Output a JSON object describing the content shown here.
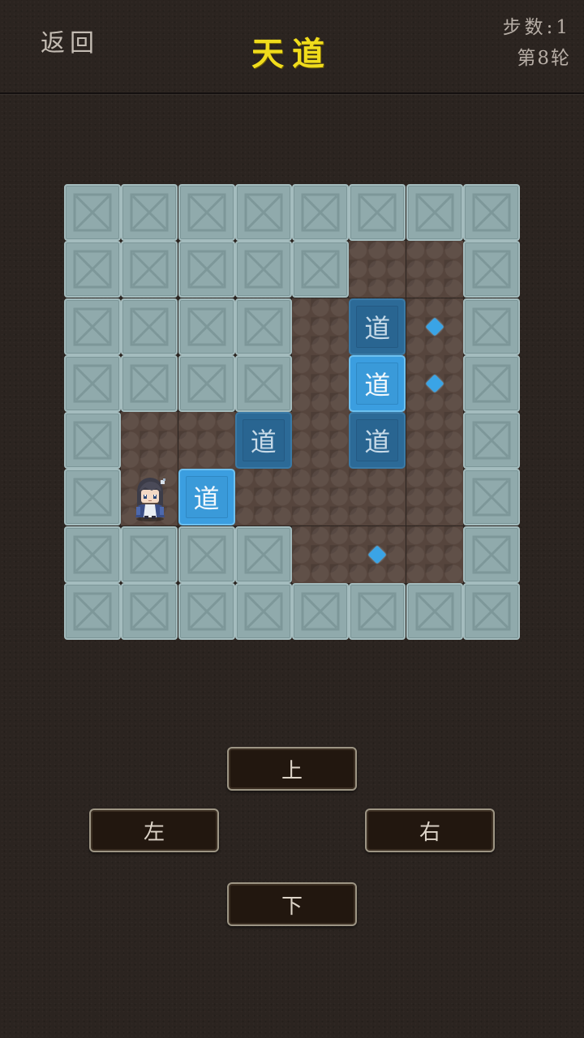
{
  "header": {
    "back_label": "返回",
    "title": "天道",
    "steps": "步数:1",
    "round": "第8轮"
  },
  "box_glyph": "道",
  "controls": {
    "up": "上",
    "left": "左",
    "right": "右",
    "down": "下"
  },
  "colors": {
    "title": "#f0dc1c",
    "wall": "#90aaac",
    "floor": "#56453d",
    "box": "#2c6a97",
    "box_on_goal": "#3b9ee0",
    "goal": "#3aa4e6"
  },
  "board": {
    "columns": 8,
    "rows": 8,
    "legend": {
      "#": "wall",
      ".": "floor"
    },
    "grid": [
      "########",
      "#####..#",
      "####...#",
      "####...#",
      "#......#",
      "#......#",
      "####...#",
      "########"
    ],
    "boxes": [
      {
        "row": 2,
        "col": 5,
        "on_goal": false
      },
      {
        "row": 3,
        "col": 5,
        "on_goal": true
      },
      {
        "row": 4,
        "col": 3,
        "on_goal": false
      },
      {
        "row": 4,
        "col": 5,
        "on_goal": false
      },
      {
        "row": 5,
        "col": 2,
        "on_goal": true
      }
    ],
    "goals": [
      {
        "row": 2,
        "col": 6
      },
      {
        "row": 3,
        "col": 6
      },
      {
        "row": 6,
        "col": 5
      }
    ],
    "player": {
      "row": 5,
      "col": 1
    }
  }
}
